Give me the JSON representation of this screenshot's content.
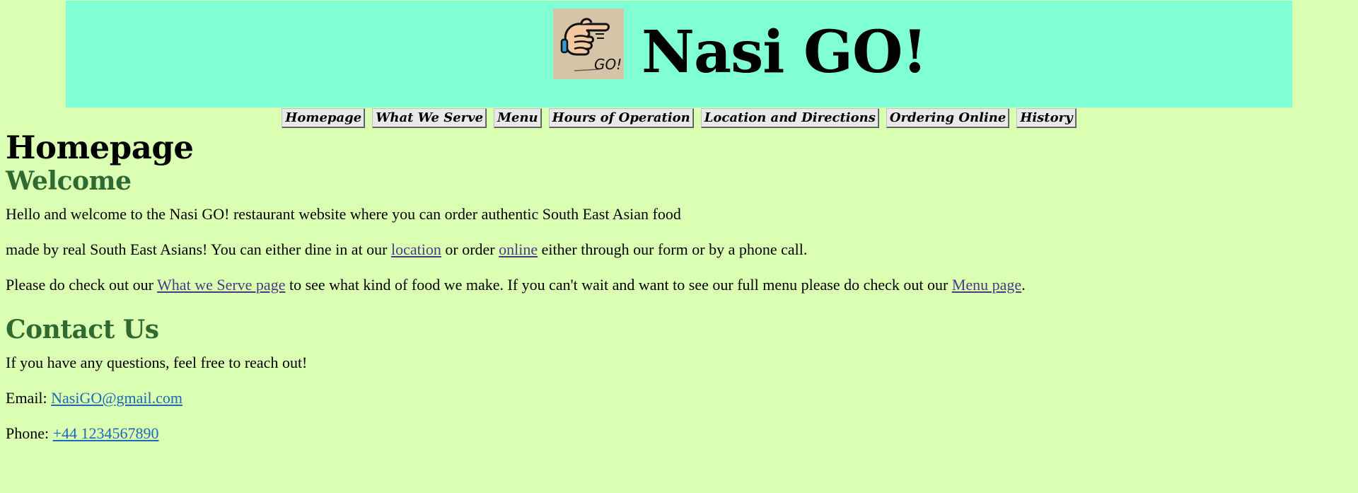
{
  "header": {
    "logo_icon": "pointing-hand-go-logo",
    "logo_text": "GO!",
    "title": "Nasi GO!"
  },
  "nav": {
    "items": [
      {
        "label": "Homepage"
      },
      {
        "label": "What We Serve"
      },
      {
        "label": "Menu"
      },
      {
        "label": "Hours of Operation"
      },
      {
        "label": "Location and Directions"
      },
      {
        "label": "Ordering Online"
      },
      {
        "label": "History"
      }
    ]
  },
  "main": {
    "page_title": "Homepage",
    "welcome": {
      "heading": "Welcome",
      "para1": "Hello and welcome to the Nasi GO! restaurant website where you can order authentic South East Asian food",
      "para2": {
        "before": "made by real South East Asians! You can either dine in at our ",
        "link_location": "location",
        "middle": " or order ",
        "link_online": "online",
        "after": " either through our form or by a phone call."
      },
      "para3": {
        "before": "Please do check out our ",
        "link_what_we_serve": "What we Serve page",
        "middle": " to see what kind of food we make. If you can't wait and want to see our full menu please do check out our ",
        "link_menu": "Menu page",
        "after": "."
      }
    },
    "contact": {
      "heading": "Contact Us",
      "intro": "If you have any questions, feel free to reach out!",
      "email_label": "Email: ",
      "email": "NasiGO@gmail.com",
      "phone_label": "Phone: ",
      "phone": "+44 1234567890"
    }
  },
  "colors": {
    "page_background": "#dafeb2",
    "banner_background": "#80ffd5",
    "section_heading": "#2f6a33",
    "visited_link": "#4a3b84",
    "contact_link": "#1d68b8"
  }
}
